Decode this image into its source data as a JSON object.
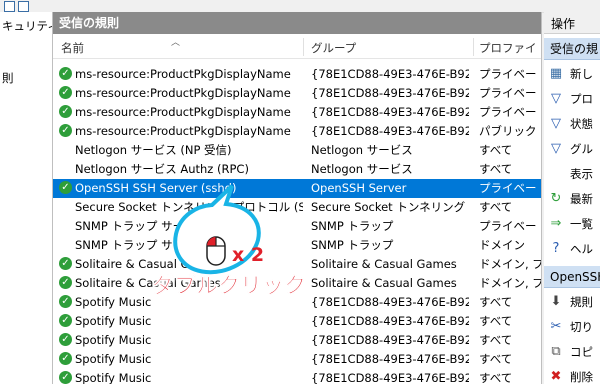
{
  "left_tree": {
    "items": [
      "キュリティ",
      "則"
    ]
  },
  "panel": {
    "title": "受信の規則",
    "columns": [
      "名前",
      "グループ",
      "プロファイ"
    ]
  },
  "rows": [
    {
      "enabled": true,
      "name": "ms-resource:ProductPkgDisplayName",
      "group": "{78E1CD88-49E3-476E-B926-...",
      "profile": "プライベー",
      "selected": false
    },
    {
      "enabled": true,
      "name": "ms-resource:ProductPkgDisplayName",
      "group": "{78E1CD88-49E3-476E-B926-...",
      "profile": "プライベー",
      "selected": false
    },
    {
      "enabled": true,
      "name": "ms-resource:ProductPkgDisplayName",
      "group": "{78E1CD88-49E3-476E-B926-...",
      "profile": "プライベー",
      "selected": false
    },
    {
      "enabled": true,
      "name": "ms-resource:ProductPkgDisplayName",
      "group": "{78E1CD88-49E3-476E-B926-...",
      "profile": "パブリック",
      "selected": false
    },
    {
      "enabled": false,
      "name": "Netlogon サービス (NP 受信)",
      "group": "Netlogon サービス",
      "profile": "すべて",
      "selected": false
    },
    {
      "enabled": false,
      "name": "Netlogon サービス Authz (RPC)",
      "group": "Netlogon サービス",
      "profile": "すべて",
      "selected": false
    },
    {
      "enabled": true,
      "name": "OpenSSH SSH Server (sshd)",
      "group": "OpenSSH Server",
      "profile": "プライベー",
      "selected": true
    },
    {
      "enabled": false,
      "name": "Secure Socket トンネリング プロトコル (SSTP ...",
      "group": "Secure Socket トンネリング プ...",
      "profile": "すべて",
      "selected": false
    },
    {
      "enabled": false,
      "name": "SNMP トラップ サービス",
      "group": "SNMP トラップ",
      "profile": "プライベー",
      "selected": false
    },
    {
      "enabled": false,
      "name": "SNMP トラップ サービス",
      "group": "SNMP トラップ",
      "profile": "ドメイン",
      "selected": false
    },
    {
      "enabled": true,
      "name": "Solitaire & Casual Games",
      "group": "Solitaire & Casual Games",
      "profile": "ドメイン, プ",
      "selected": false
    },
    {
      "enabled": true,
      "name": "Solitaire & Casual Games",
      "group": "Solitaire & Casual Games",
      "profile": "ドメイン, プ",
      "selected": false
    },
    {
      "enabled": true,
      "name": "Spotify Music",
      "group": "{78E1CD88-49E3-476E-B926-...",
      "profile": "すべて",
      "selected": false
    },
    {
      "enabled": true,
      "name": "Spotify Music",
      "group": "{78E1CD88-49E3-476E-B926-...",
      "profile": "すべて",
      "selected": false
    },
    {
      "enabled": true,
      "name": "Spotify Music",
      "group": "{78E1CD88-49E3-476E-B926-...",
      "profile": "すべて",
      "selected": false
    },
    {
      "enabled": true,
      "name": "Spotify Music",
      "group": "{78E1CD88-49E3-476E-B926-...",
      "profile": "すべて",
      "selected": false
    },
    {
      "enabled": true,
      "name": "Spotify Music",
      "group": "{78E1CD88-49E3-476E-B926-...",
      "profile": "すべて",
      "selected": false
    }
  ],
  "actions": {
    "title": "操作",
    "section1": "受信の規",
    "items1": [
      {
        "icon": "new-rule-icon",
        "label": "新し"
      },
      {
        "icon": "filter-icon",
        "label": "プロ"
      },
      {
        "icon": "filter-icon",
        "label": "状態"
      },
      {
        "icon": "filter-icon",
        "label": "グル"
      },
      {
        "icon": "none",
        "label": "表示"
      },
      {
        "icon": "refresh-icon",
        "label": "最新"
      },
      {
        "icon": "export-icon",
        "label": "一覧"
      },
      {
        "icon": "help-icon",
        "label": "ヘル"
      }
    ],
    "section2": "OpenSSH",
    "items2": [
      {
        "icon": "disable-icon",
        "label": "規則"
      },
      {
        "icon": "cut-icon",
        "label": "切り"
      },
      {
        "icon": "copy-icon",
        "label": "コピ"
      },
      {
        "icon": "delete-icon",
        "label": "削除"
      }
    ]
  },
  "annotation": {
    "multiplier": "x 2",
    "caption": "ダブルクリック",
    "colors": {
      "text": "#e0202a",
      "bubble": "#19b4e6"
    }
  },
  "colors": {
    "selection": "#0078d7",
    "title_bar": "#8a8a8a",
    "enabled_check": "#2e9e3a"
  }
}
